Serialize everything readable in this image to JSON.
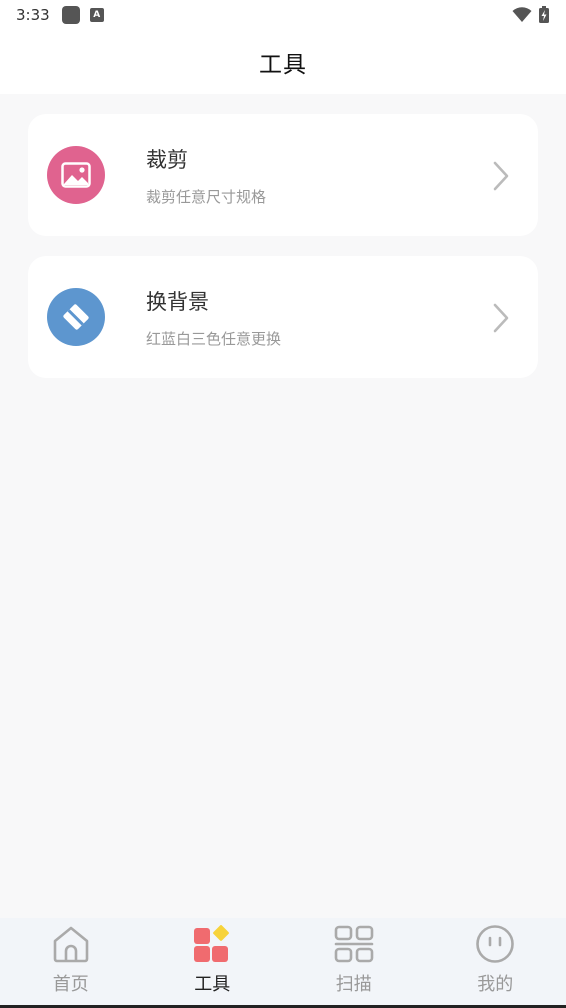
{
  "status_bar": {
    "time": "3:33",
    "notif_letter": "A"
  },
  "header": {
    "title": "工具"
  },
  "tools": [
    {
      "title": "裁剪",
      "subtitle": "裁剪任意尺寸规格",
      "icon": "image-icon",
      "color": "#e0638f"
    },
    {
      "title": "换背景",
      "subtitle": "红蓝白三色任意更换",
      "icon": "eraser-icon",
      "color": "#5d96cf"
    }
  ],
  "nav": [
    {
      "label": "首页",
      "icon": "home-icon",
      "active": false
    },
    {
      "label": "工具",
      "icon": "tools-icon",
      "active": true
    },
    {
      "label": "扫描",
      "icon": "scan-icon",
      "active": false
    },
    {
      "label": "我的",
      "icon": "profile-icon",
      "active": false
    }
  ],
  "colors": {
    "accent_red": "#f06b6f",
    "accent_yellow": "#f7d33a",
    "inactive": "#aaaaaa"
  }
}
